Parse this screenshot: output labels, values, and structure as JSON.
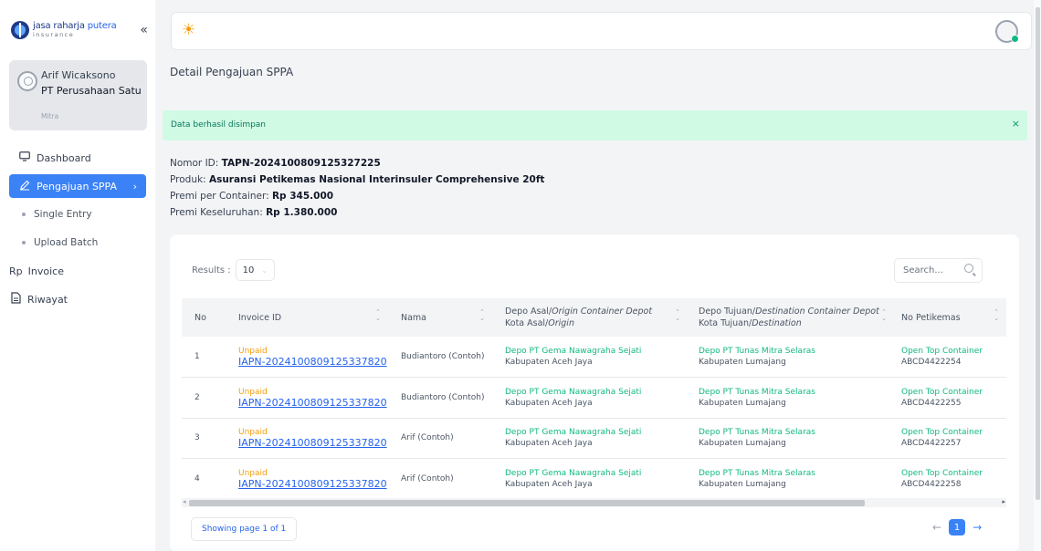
{
  "app": {
    "logo_main": "jasa raharja",
    "logo_accent": " putera",
    "logo_sub": "insurance",
    "collapse_icon": "«"
  },
  "user": {
    "name": "Arif Wicaksono",
    "company": "PT Perusahaan Satu",
    "role": "Mitra"
  },
  "sidebar": {
    "items": [
      {
        "label": "Dashboard",
        "icon": "monitor-icon"
      },
      {
        "label": "Pengajuan SPPA",
        "icon": "pencil-icon",
        "active": true
      },
      {
        "label": "Single Entry",
        "sub": true
      },
      {
        "label": "Upload Batch",
        "sub": true
      },
      {
        "label": "Invoice",
        "icon": "rupiah-icon",
        "icon_text": "Rp"
      },
      {
        "label": "Riwayat",
        "icon": "document-icon"
      }
    ]
  },
  "page": {
    "title": "Detail Pengajuan SPPA"
  },
  "alert": {
    "message": "Data berhasil disimpan",
    "close": "×",
    "color": "#d1fae5"
  },
  "details": {
    "nomor_label": "Nomor ID: ",
    "nomor_value": "TAPN-2024100809125327225",
    "produk_label": "Produk: ",
    "produk_value": "Asuransi Petikemas Nasional Interinsuler Comprehensive 20ft",
    "premi_container_label": "Premi per Container: ",
    "premi_container_value": "Rp 345.000",
    "premi_total_label": "Premi Keseluruhan: ",
    "premi_total_value": "Rp 1.380.000"
  },
  "table_controls": {
    "results_label": "Results :",
    "results_value": "10",
    "search_placeholder": "Search..."
  },
  "table": {
    "headers": {
      "no": "No",
      "invoice": "Invoice ID",
      "nama": "Nama",
      "depo_asal_a": "Depo Asal/",
      "depo_asal_b": "Origin Container Depot",
      "kota_asal_a": "Kota Asal/",
      "kota_asal_b": "Origin",
      "depo_tujuan_a": "Depo Tujuan/",
      "depo_tujuan_b": "Destination Container Depot",
      "kota_tujuan_a": "Kota Tujuan/",
      "kota_tujuan_b": "Destination",
      "petikemas": "No Petikemas"
    },
    "rows": [
      {
        "no": "1",
        "status": "Unpaid",
        "invoice": "IAPN-2024100809125337820",
        "nama": "Budiantoro (Contoh)",
        "depo_asal": "Depo PT Gema Nawagraha Sejati",
        "kota_asal": "Kabupaten Aceh Jaya",
        "depo_tujuan": "Depo PT Tunas Mitra Selaras",
        "kota_tujuan": "Kabupaten Lumajang",
        "jenis": "Open Top Container",
        "petikemas": "ABCD4422254"
      },
      {
        "no": "2",
        "status": "Unpaid",
        "invoice": "IAPN-2024100809125337820",
        "nama": "Budiantoro (Contoh)",
        "depo_asal": "Depo PT Gema Nawagraha Sejati",
        "kota_asal": "Kabupaten Aceh Jaya",
        "depo_tujuan": "Depo PT Tunas Mitra Selaras",
        "kota_tujuan": "Kabupaten Lumajang",
        "jenis": "Open Top Container",
        "petikemas": "ABCD4422255"
      },
      {
        "no": "3",
        "status": "Unpaid",
        "invoice": "IAPN-2024100809125337820",
        "nama": "Arif (Contoh)",
        "depo_asal": "Depo PT Gema Nawagraha Sejati",
        "kota_asal": "Kabupaten Aceh Jaya",
        "depo_tujuan": "Depo PT Tunas Mitra Selaras",
        "kota_tujuan": "Kabupaten Lumajang",
        "jenis": "Open Top Container",
        "petikemas": "ABCD4422257"
      },
      {
        "no": "4",
        "status": "Unpaid",
        "invoice": "IAPN-2024100809125337820",
        "nama": "Arif (Contoh)",
        "depo_asal": "Depo PT Gema Nawagraha Sejati",
        "kota_asal": "Kabupaten Aceh Jaya",
        "depo_tujuan": "Depo PT Tunas Mitra Selaras",
        "kota_tujuan": "Kabupaten Lumajang",
        "jenis": "Open Top Container",
        "petikemas": "ABCD4422258"
      }
    ]
  },
  "pagination": {
    "showing": "Showing page 1 of 1",
    "current_page": "1",
    "prev": "←",
    "next": "→"
  },
  "colors": {
    "accent": "#3b82f6",
    "success": "#10b981",
    "warning": "#f59e0b",
    "link": "#2563eb"
  }
}
